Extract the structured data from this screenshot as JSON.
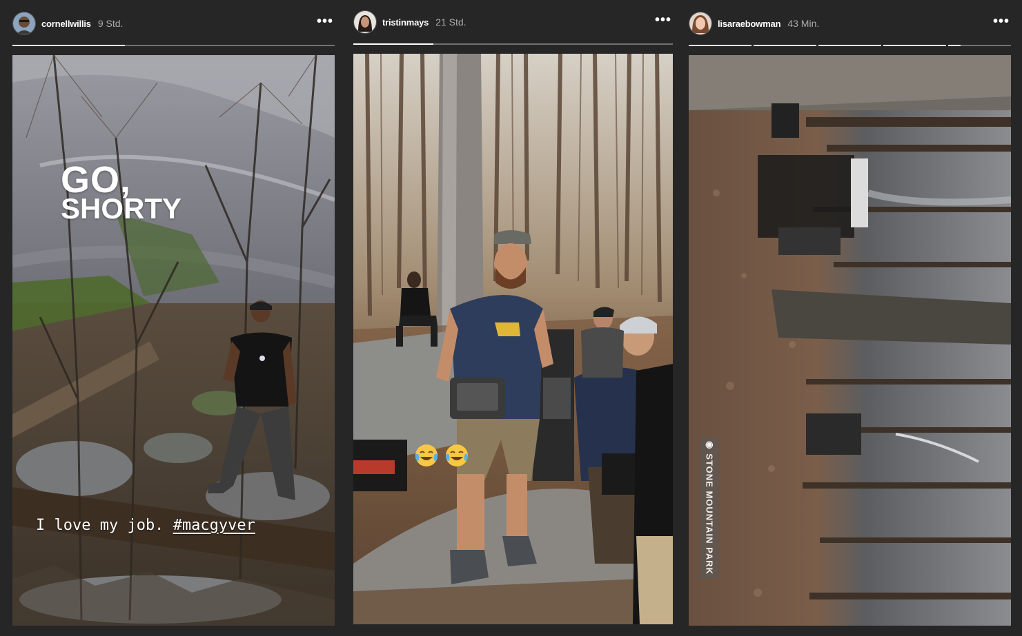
{
  "stories": [
    {
      "username": "cornellwillis",
      "timestamp": "9 Std.",
      "segments": [
        0.35
      ],
      "caption_line1": "GO,",
      "caption_line2": "SHORTY",
      "caption_text": "I love my job.",
      "caption_hashtag": "#macgyver"
    },
    {
      "username": "tristinmays",
      "timestamp": "21 Std.",
      "segments": [
        0.25
      ],
      "emoji": [
        "face-with-tears-of-joy",
        "face-with-tears-of-joy"
      ],
      "emoji_glyphs": [
        "😂",
        "😂"
      ]
    },
    {
      "username": "lisaraebowman",
      "timestamp": "43 Min.",
      "segments": [
        1,
        1,
        1,
        1,
        0.2
      ],
      "location_sticker": "STONE MOUNTAIN PARK"
    }
  ],
  "more_label": "•••",
  "colors": {
    "background": "#262626",
    "progress_fill": "#ffffff",
    "progress_track": "rgba(255,255,255,0.35)"
  }
}
